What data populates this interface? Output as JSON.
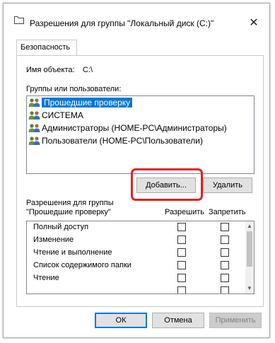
{
  "window": {
    "title": "Разрешения для группы \"Локальный диск (C:)\"",
    "close_glyph": "✕"
  },
  "tabs": [
    {
      "label": "Безопасность",
      "active": true
    }
  ],
  "object": {
    "label": "Имя объекта:",
    "value": "C:\\"
  },
  "groups": {
    "label": "Группы или пользователи:",
    "items": [
      {
        "label": "Прошедшие проверку",
        "selected": true,
        "icon": "users-icon"
      },
      {
        "label": "СИСТЕМА",
        "selected": false,
        "icon": "users-icon"
      },
      {
        "label": "Администраторы (HOME-PC\\Администраторы)",
        "selected": false,
        "icon": "users-icon"
      },
      {
        "label": "Пользователи (HOME-PC\\Пользователи)",
        "selected": false,
        "icon": "users-icon"
      }
    ]
  },
  "buttons": {
    "add": "Добавить...",
    "remove": "Удалить",
    "ok": "ОК",
    "cancel": "Отмена",
    "apply": "Применить"
  },
  "permissions": {
    "header_line1": "Разрешения для группы",
    "header_line2": "\"Прошедшие проверку\"",
    "allow_label": "Разрешить",
    "deny_label": "Запретить",
    "rows": [
      {
        "name": "Полный доступ",
        "allow": false,
        "deny": false
      },
      {
        "name": "Изменение",
        "allow": false,
        "deny": false
      },
      {
        "name": "Чтение и выполнение",
        "allow": false,
        "deny": false
      },
      {
        "name": "Список содержимого папки",
        "allow": false,
        "deny": false
      },
      {
        "name": "Чтение",
        "allow": false,
        "deny": false
      },
      {
        "name": "",
        "allow": false,
        "deny": false
      }
    ]
  },
  "colors": {
    "selection": "#0078d7",
    "highlight_annotation": "#e81e1e"
  }
}
